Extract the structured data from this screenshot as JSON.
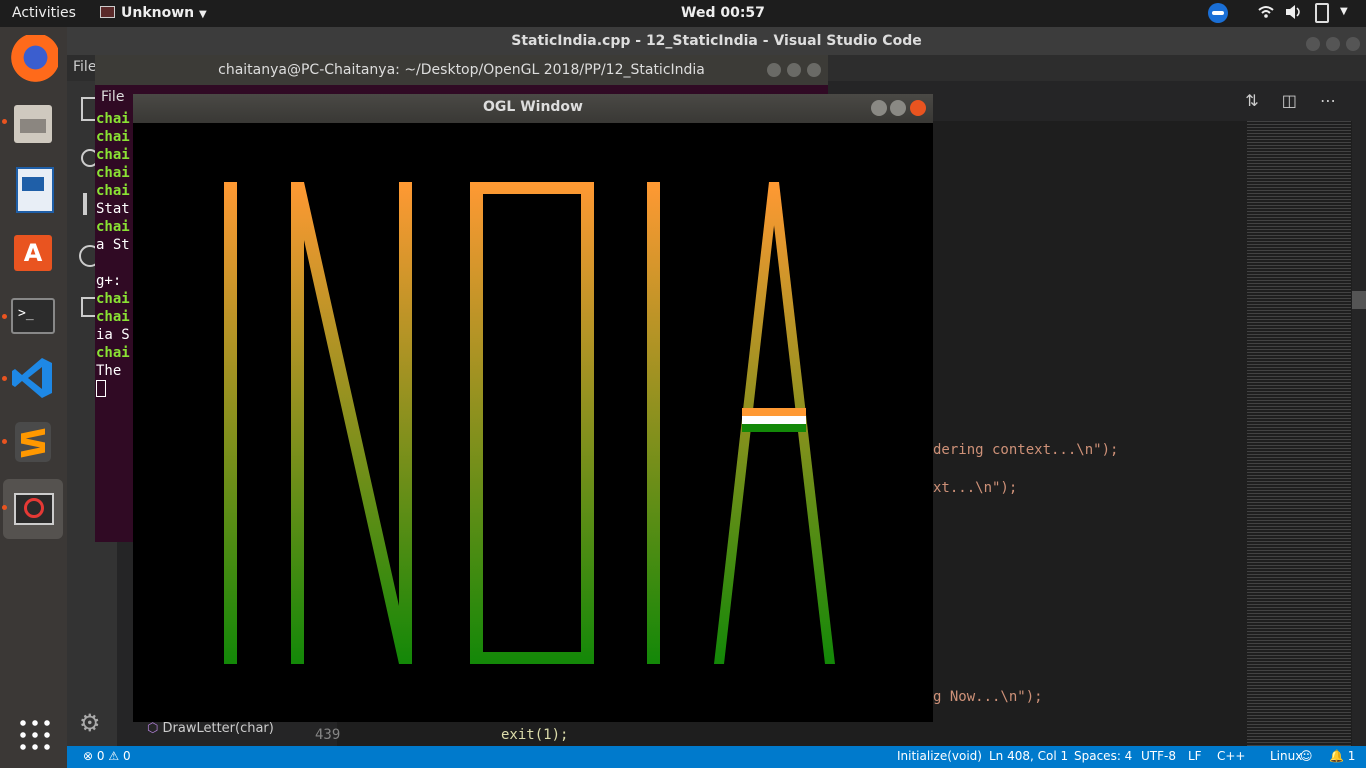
{
  "topbar": {
    "activities": "Activities",
    "app_menu": "Unknown",
    "clock": "Wed 00:57"
  },
  "vscode": {
    "title": "StaticIndia.cpp - 12_StaticIndia - Visual Studio Code",
    "menu_file": "File",
    "code_fragments": [
      "dering context...\\n\");",
      "xt...\\n\");",
      "g Now...\\n\");",
      "exit(1);"
    ],
    "outline_item": "DrawLetter(char)",
    "line_number": "439",
    "status": {
      "errors": "0",
      "warnings": "0",
      "function": "Initialize(void)",
      "position": "Ln 408, Col 1",
      "spaces": "Spaces: 4",
      "encoding": "UTF-8",
      "eol": "LF",
      "language": "C++",
      "platform": "Linux",
      "notifications": "1"
    }
  },
  "terminal": {
    "title": "chaitanya@PC-Chaitanya: ~/Desktop/OpenGL 2018/PP/12_StaticIndia",
    "menu_file": "File",
    "lines": [
      {
        "text": "chai",
        "prompt": true
      },
      {
        "text": "chai",
        "prompt": true
      },
      {
        "text": "chai",
        "prompt": true
      },
      {
        "text": "chai",
        "prompt": true
      },
      {
        "text": "chai",
        "prompt": true
      },
      {
        "text": "Stat",
        "prompt": false
      },
      {
        "text": "chai",
        "prompt": true
      },
      {
        "text": "a St",
        "prompt": false
      },
      {
        "text": "",
        "prompt": false
      },
      {
        "text": "g+: ",
        "prompt": false
      },
      {
        "text": "chai",
        "prompt": true
      },
      {
        "text": "chai",
        "prompt": true
      },
      {
        "text": "ia S",
        "prompt": false
      },
      {
        "text": "chai",
        "prompt": true
      },
      {
        "text": "The ",
        "prompt": false
      }
    ]
  },
  "ogl": {
    "title": "OGL Window",
    "colors": {
      "saffron": "#ff9933",
      "white": "#ffffff",
      "green": "#138808",
      "background": "#000000"
    }
  },
  "dock": {
    "items": [
      "firefox-icon",
      "files-icon",
      "writer-icon",
      "software-icon",
      "terminal-icon",
      "vscode-icon",
      "sublime-icon",
      "ogl-app-icon"
    ],
    "show_apps": "show-apps-icon"
  }
}
